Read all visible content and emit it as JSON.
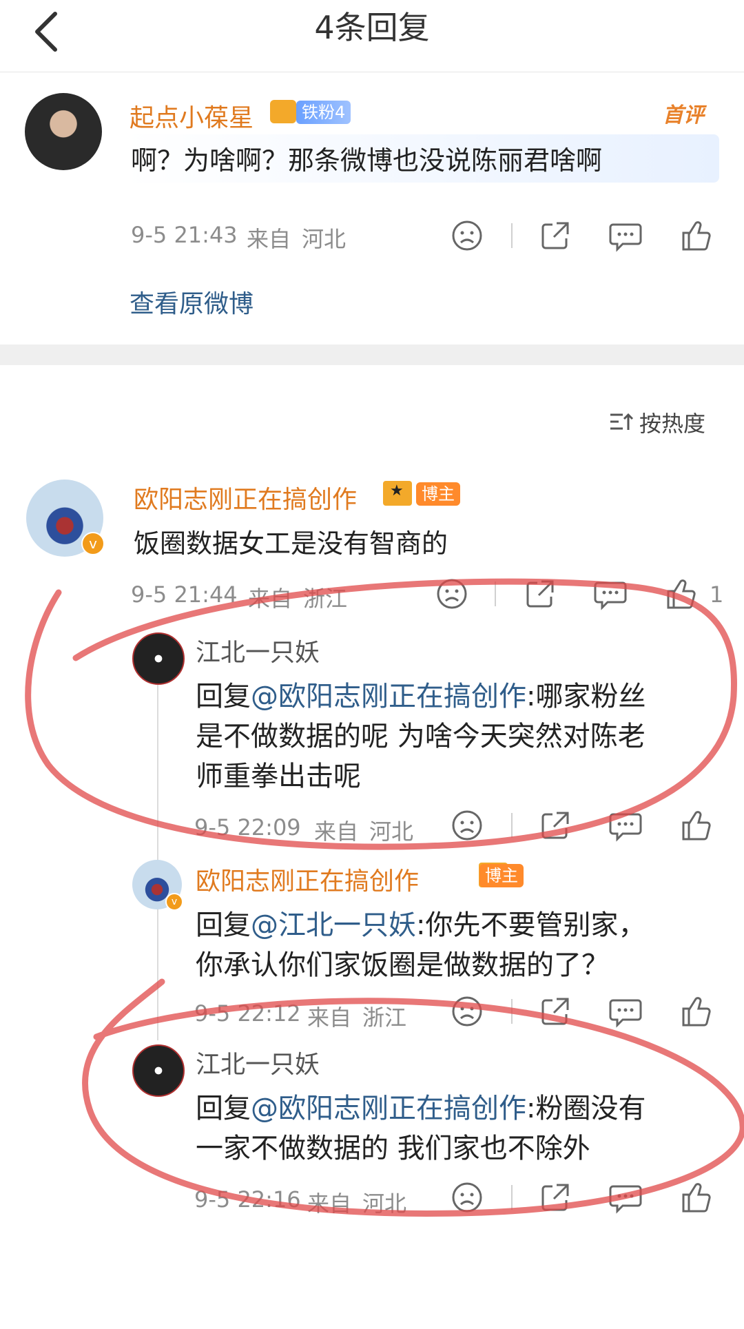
{
  "header": {
    "title": "4条回复"
  },
  "main_comment": {
    "username": "起点小葆星",
    "fan_badge": "铁粉4",
    "first_comment_tag": "首评",
    "text": "啊？为啥啊？那条微博也没说陈丽君啥啊",
    "time": "9-5 21:43",
    "from_label": "来自",
    "location": "河北",
    "view_original": "查看原微博"
  },
  "sort": {
    "label": "按热度"
  },
  "thread": [
    {
      "username": "欧阳志刚正在搞创作",
      "host_badge": "博主",
      "text": "饭圈数据女工是没有智商的",
      "time": "9-5 21:44",
      "from_label": "来自",
      "location": "浙江",
      "like_count": "1"
    }
  ],
  "replies": [
    {
      "username": "江北一只妖",
      "reply_prefix": "回复",
      "mention": "@欧阳志刚正在搞创作",
      "line1": ":哪家粉丝",
      "line2": "是不做数据的呢 为啥今天突然对陈老",
      "line3": "师重拳出击呢",
      "time": "9-5 22:09",
      "from_label": "来自",
      "location": "河北"
    },
    {
      "username": "欧阳志刚正在搞创作",
      "host_badge": "博主",
      "reply_prefix": "回复",
      "mention": "@江北一只妖",
      "line1": ":你先不要管别家，",
      "line2": "你承认你们家饭圈是做数据的了？",
      "time": "9-5 22:12",
      "from_label": "来自",
      "location": "浙江"
    },
    {
      "username": "江北一只妖",
      "reply_prefix": "回复",
      "mention": "@欧阳志刚正在搞创作",
      "line1": ":粉圈没有",
      "line2": "一家不做数据的 我们家也不除外",
      "time": "9-5 22:16",
      "from_label": "来自",
      "location": "河北"
    }
  ],
  "icons": [
    "back-arrow-icon",
    "sad-face-icon",
    "share-icon",
    "comment-icon",
    "like-icon",
    "sort-icon",
    "verified-v-icon",
    "crown-icon"
  ],
  "colors": {
    "orange_name": "#e07a1f",
    "mention_blue": "#2f5d8a",
    "meta_gray": "#8c8c8c",
    "annotation_red": "#e04a4a"
  }
}
